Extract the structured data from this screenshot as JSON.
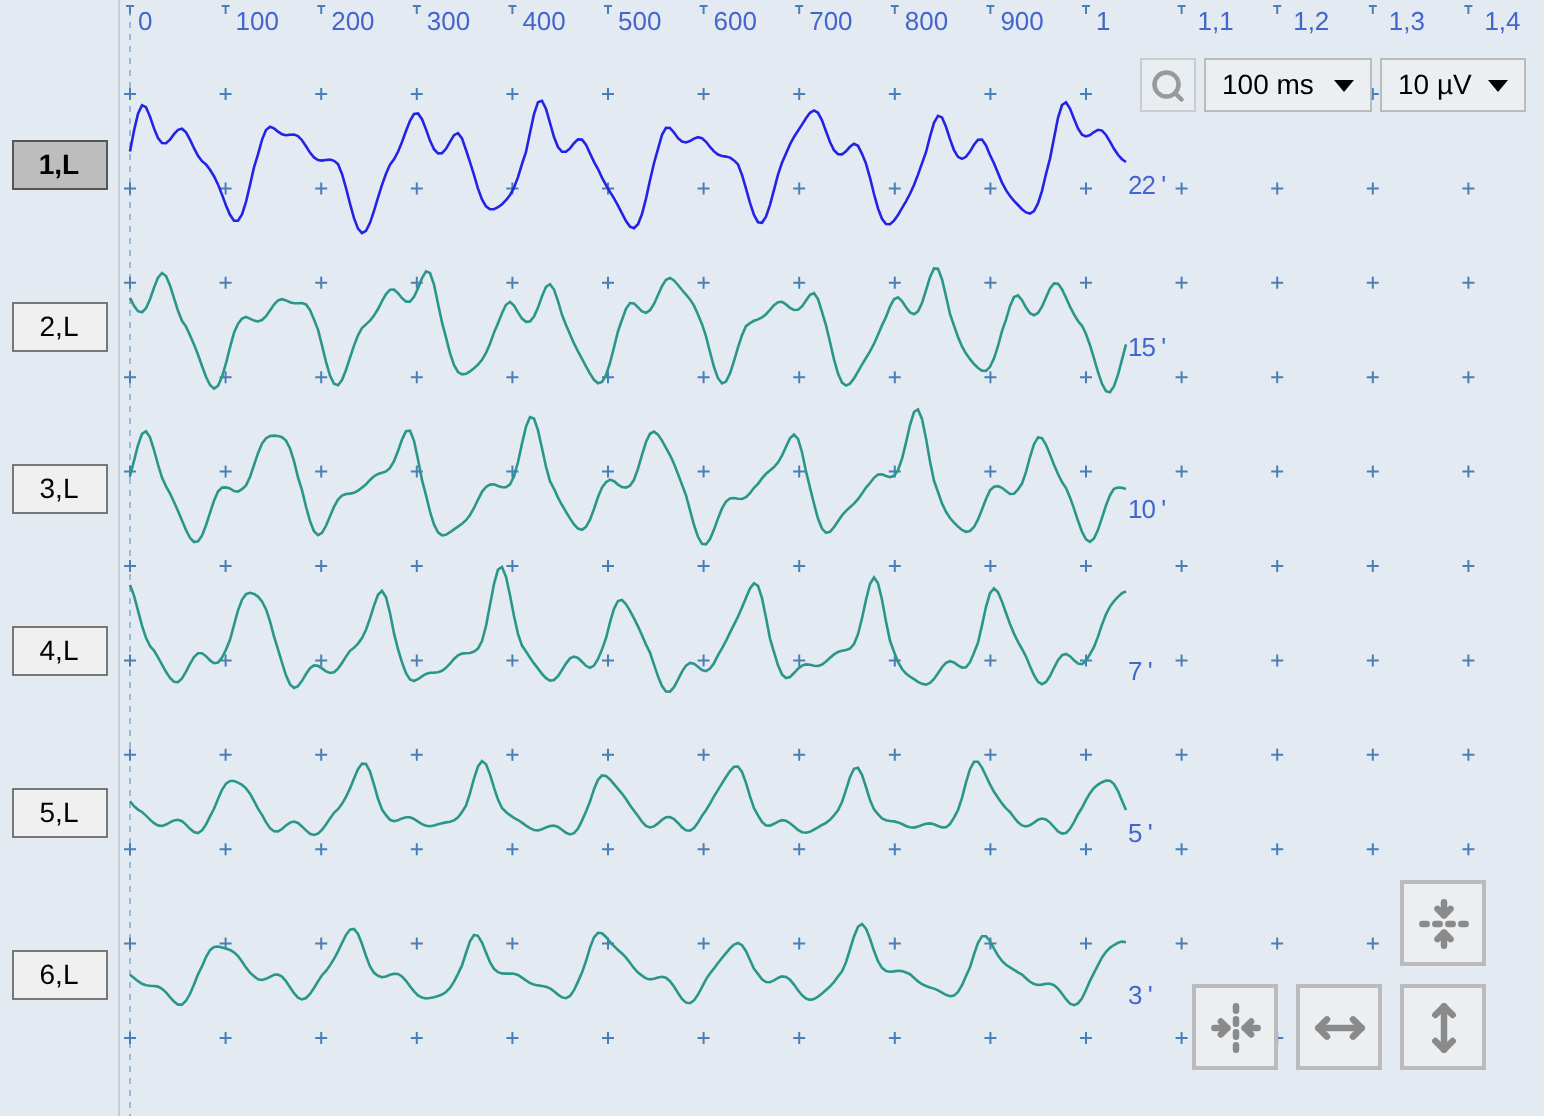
{
  "time_axis": {
    "ticks": [
      "0",
      "100",
      "200",
      "300",
      "400",
      "500",
      "600",
      "700",
      "800",
      "900",
      "1",
      "1,1",
      "1,2",
      "1,3",
      "1,4"
    ]
  },
  "channels": [
    {
      "label": "1,L",
      "reading": "22 '",
      "selected": true
    },
    {
      "label": "2,L",
      "reading": "15 '",
      "selected": false
    },
    {
      "label": "3,L",
      "reading": "10 '",
      "selected": false
    },
    {
      "label": "4,L",
      "reading": "7 '",
      "selected": false
    },
    {
      "label": "5,L",
      "reading": "5 '",
      "selected": false
    },
    {
      "label": "6,L",
      "reading": "3 '",
      "selected": false
    }
  ],
  "toolbar": {
    "time_scale": "100 ms",
    "amplitude_scale": "10 µV"
  }
}
